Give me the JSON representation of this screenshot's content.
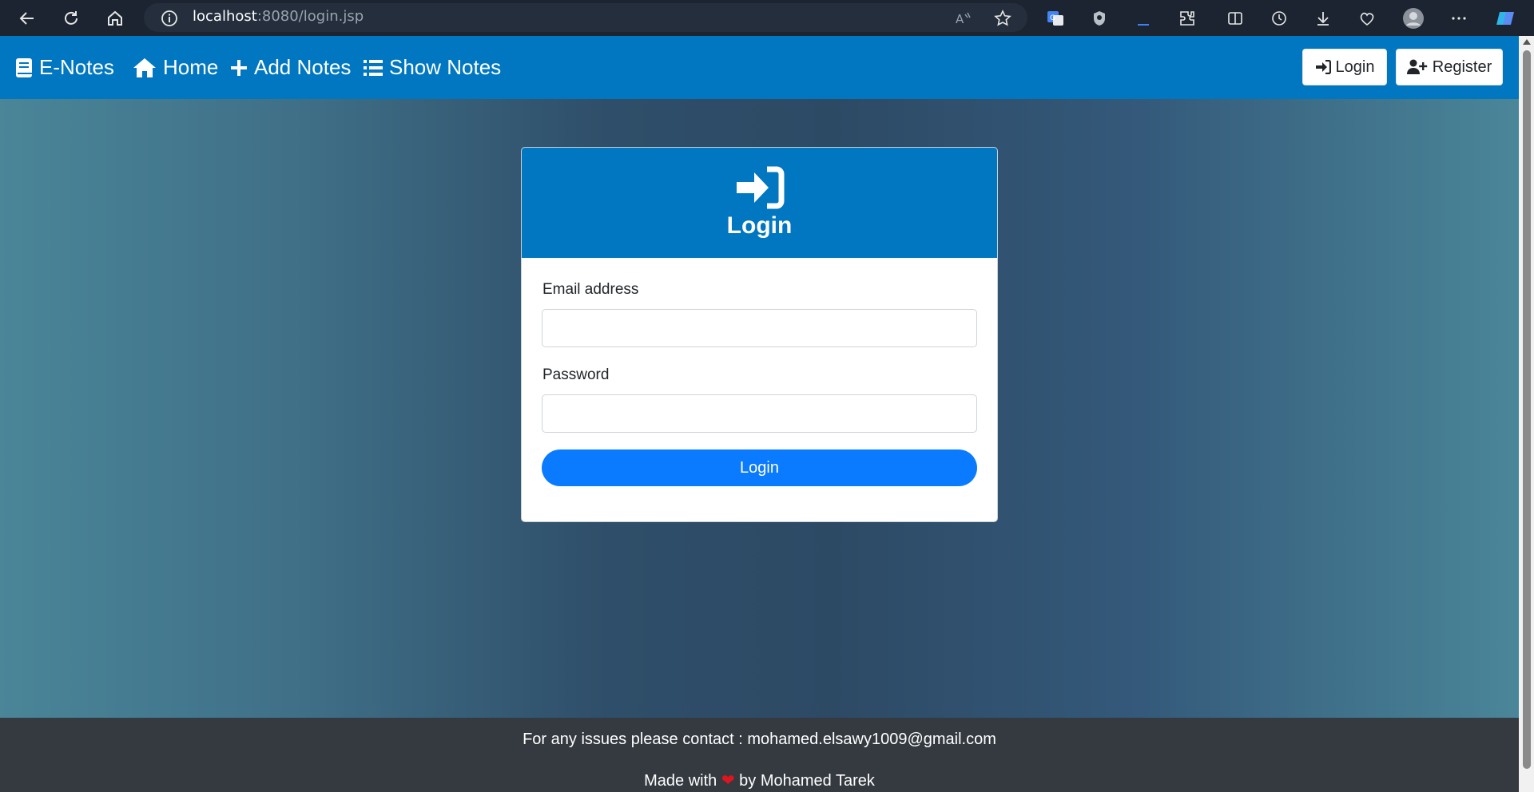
{
  "browser": {
    "url_host": "localhost",
    "url_rest": ":8080/login.jsp",
    "icons": [
      "back-arrow-icon",
      "refresh-icon",
      "home-icon",
      "info-icon",
      "read-aloud-icon",
      "favorite-star-icon",
      "translate-icon",
      "shield-icon",
      "extensions-icon",
      "split-screen-icon",
      "history-icon",
      "download-icon",
      "browser-essentials-icon",
      "profile-avatar-icon",
      "more-menu-icon",
      "copilot-icon"
    ]
  },
  "nav": {
    "brand": "E-Notes",
    "home": "Home",
    "add_notes": "Add Notes",
    "show_notes": "Show Notes",
    "login_button": "Login",
    "register_button": "Register"
  },
  "login_card": {
    "title": "Login",
    "email_label": "Email address",
    "email_value": "",
    "password_label": "Password",
    "password_value": "",
    "submit_label": "Login"
  },
  "footer": {
    "contact": "For any issues please contact : mohamed.elsawy1009@gmail.com",
    "made_with_prefix": "Made with",
    "heart": "❤",
    "made_with_suffix": "by Mohamed Tarek"
  },
  "colors": {
    "nav_blue": "#0077c0",
    "button_blue": "#0a7bff",
    "footer_dark": "#343a40",
    "heart_red": "#e0141e"
  }
}
